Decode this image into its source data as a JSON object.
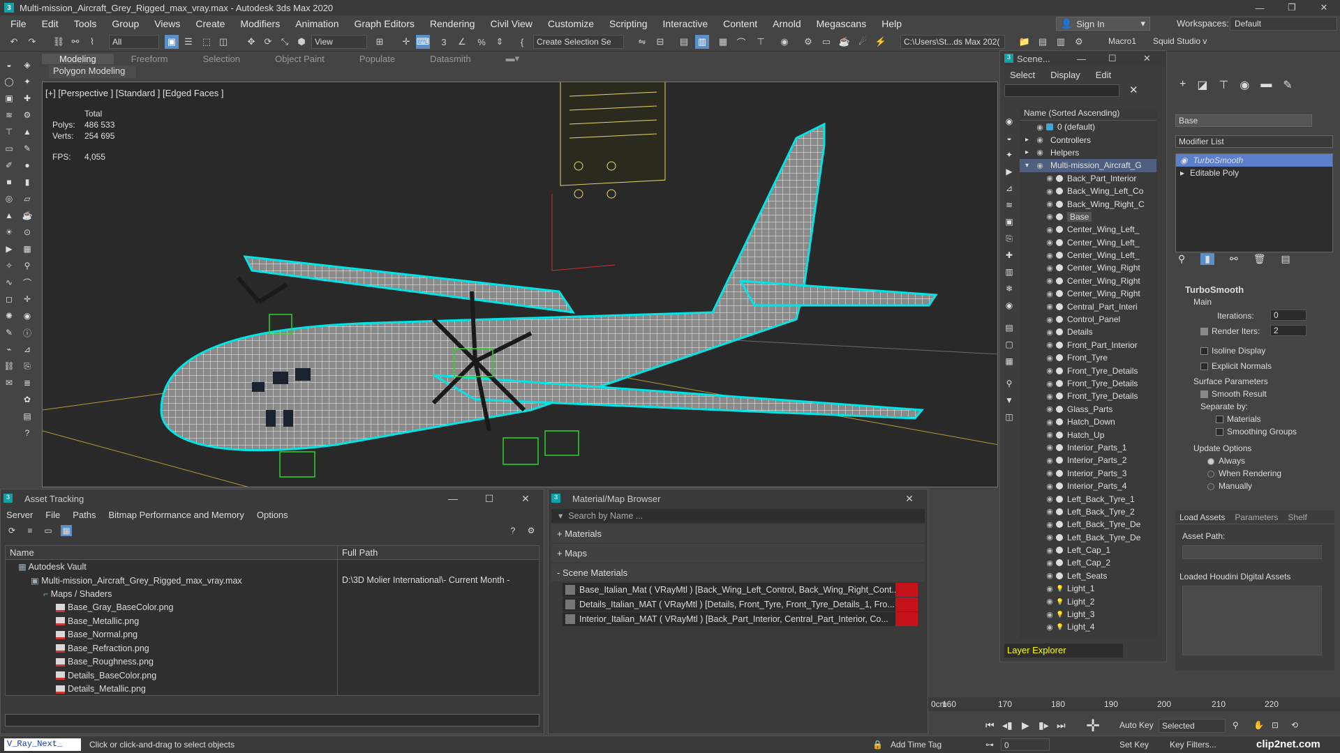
{
  "window": {
    "title": "Multi-mission_Aircraft_Grey_Rigged_max_vray.max - Autodesk 3ds Max 2020",
    "app_badge": "3"
  },
  "menu": [
    "File",
    "Edit",
    "Tools",
    "Group",
    "Views",
    "Create",
    "Modifiers",
    "Animation",
    "Graph Editors",
    "Rendering",
    "Civil View",
    "Customize",
    "Scripting",
    "Interactive",
    "Content",
    "Arnold",
    "Megascans",
    "Help"
  ],
  "account": {
    "sign_in": "Sign In",
    "workspaces_label": "Workspaces:",
    "workspace": "Default"
  },
  "toolbar": {
    "filter": "All",
    "view": "View",
    "selection_set": "Create Selection Se",
    "path": "C:\\Users\\St...ds Max 202(",
    "macro": "Macro1",
    "squid": "Squid Studio v"
  },
  "ribbon": {
    "tabs": [
      "Modeling",
      "Freeform",
      "Selection",
      "Object Paint",
      "Populate",
      "Datasmith"
    ],
    "sub": "Polygon Modeling"
  },
  "viewport": {
    "label": "[+] [Perspective ] [Standard ] [Edged Faces ]",
    "total_label": "Total",
    "polys_label": "Polys:",
    "polys": "486 533",
    "verts_label": "Verts:",
    "verts": "254 695",
    "fps_label": "FPS:",
    "fps": "4,055"
  },
  "scene_explorer": {
    "title": "Scene...",
    "menus": [
      "Select",
      "Display",
      "Edit"
    ],
    "column": "Name (Sorted Ascending)",
    "rows": [
      {
        "name": "0 (default)",
        "level": 0,
        "type": "layer"
      },
      {
        "name": "Controllers",
        "level": 0,
        "type": "group"
      },
      {
        "name": "Helpers",
        "level": 0,
        "type": "group"
      },
      {
        "name": "Multi-mission_Aircraft_G",
        "level": 0,
        "type": "group-open",
        "selected": true
      },
      {
        "name": "Back_Part_Interior",
        "level": 1
      },
      {
        "name": "Back_Wing_Left_Co",
        "level": 1
      },
      {
        "name": "Back_Wing_Right_C",
        "level": 1
      },
      {
        "name": "Base",
        "level": 1,
        "highlight": true
      },
      {
        "name": "Center_Wing_Left_",
        "level": 1
      },
      {
        "name": "Center_Wing_Left_",
        "level": 1
      },
      {
        "name": "Center_Wing_Left_",
        "level": 1
      },
      {
        "name": "Center_Wing_Right",
        "level": 1
      },
      {
        "name": "Center_Wing_Right",
        "level": 1
      },
      {
        "name": "Center_Wing_Right",
        "level": 1
      },
      {
        "name": "Central_Part_Interi",
        "level": 1
      },
      {
        "name": "Control_Panel",
        "level": 1
      },
      {
        "name": "Details",
        "level": 1
      },
      {
        "name": "Front_Part_Interior",
        "level": 1
      },
      {
        "name": "Front_Tyre",
        "level": 1
      },
      {
        "name": "Front_Tyre_Details",
        "level": 1
      },
      {
        "name": "Front_Tyre_Details",
        "level": 1
      },
      {
        "name": "Front_Tyre_Details",
        "level": 1
      },
      {
        "name": "Glass_Parts",
        "level": 1
      },
      {
        "name": "Hatch_Down",
        "level": 1
      },
      {
        "name": "Hatch_Up",
        "level": 1
      },
      {
        "name": "Interior_Parts_1",
        "level": 1
      },
      {
        "name": "Interior_Parts_2",
        "level": 1
      },
      {
        "name": "Interior_Parts_3",
        "level": 1
      },
      {
        "name": "Interior_Parts_4",
        "level": 1
      },
      {
        "name": "Left_Back_Tyre_1",
        "level": 1
      },
      {
        "name": "Left_Back_Tyre_2",
        "level": 1
      },
      {
        "name": "Left_Back_Tyre_De",
        "level": 1
      },
      {
        "name": "Left_Back_Tyre_De",
        "level": 1
      },
      {
        "name": "Left_Cap_1",
        "level": 1
      },
      {
        "name": "Left_Cap_2",
        "level": 1
      },
      {
        "name": "Left_Seats",
        "level": 1
      },
      {
        "name": "Light_1",
        "level": 1,
        "light": true
      },
      {
        "name": "Light_2",
        "level": 1,
        "light": true
      },
      {
        "name": "Light_3",
        "level": 1,
        "light": true
      },
      {
        "name": "Light_4",
        "level": 1,
        "light": true
      }
    ],
    "footer": "Layer Explorer"
  },
  "command_panel": {
    "object_name": "Base",
    "modifier_list": "Modifier List",
    "stack": [
      "TurboSmooth",
      "Editable Poly"
    ],
    "turbosmooth": {
      "title": "TurboSmooth",
      "main": "Main",
      "iterations_label": "Iterations:",
      "iterations": "0",
      "render_iters_label": "Render Iters:",
      "render_iters": "2",
      "isoline": "Isoline Display",
      "explicit_normals": "Explicit Normals",
      "surface_params": "Surface Parameters",
      "smooth_result": "Smooth Result",
      "separate_by": "Separate by:",
      "materials": "Materials",
      "smoothing_groups": "Smoothing Groups",
      "update_options": "Update Options",
      "always": "Always",
      "when_rendering": "When Rendering",
      "manually": "Manually"
    },
    "houdini": {
      "tabs": [
        "Load Assets",
        "Parameters",
        "Shelf"
      ],
      "asset_path": "Asset Path:",
      "loaded": "Loaded Houdini Digital Assets"
    }
  },
  "asset_tracking": {
    "title": "Asset Tracking",
    "menus": [
      "Server",
      "File",
      "Paths",
      "Bitmap Performance and Memory",
      "Options"
    ],
    "columns": [
      "Name",
      "Full Path"
    ],
    "rows": [
      {
        "name": "Autodesk Vault",
        "path": "",
        "indent": 1,
        "kind": "vault"
      },
      {
        "name": "Multi-mission_Aircraft_Grey_Rigged_max_vray.max",
        "path": "D:\\3D Molier International\\- Current Month -",
        "indent": 2,
        "kind": "max"
      },
      {
        "name": "Maps / Shaders",
        "path": "",
        "indent": 3,
        "kind": "maps"
      },
      {
        "name": "Base_Gray_BaseColor.png",
        "path": "",
        "indent": 4,
        "kind": "png"
      },
      {
        "name": "Base_Metallic.png",
        "path": "",
        "indent": 4,
        "kind": "png"
      },
      {
        "name": "Base_Normal.png",
        "path": "",
        "indent": 4,
        "kind": "png"
      },
      {
        "name": "Base_Refraction.png",
        "path": "",
        "indent": 4,
        "kind": "png"
      },
      {
        "name": "Base_Roughness.png",
        "path": "",
        "indent": 4,
        "kind": "png"
      },
      {
        "name": "Details_BaseColor.png",
        "path": "",
        "indent": 4,
        "kind": "png"
      },
      {
        "name": "Details_Metallic.png",
        "path": "",
        "indent": 4,
        "kind": "png"
      }
    ]
  },
  "material_browser": {
    "title": "Material/Map Browser",
    "search": "Search by Name ...",
    "categories": [
      "+ Materials",
      "+ Maps",
      "- Scene Materials"
    ],
    "items": [
      "Base_Italian_Mat ( VRayMtl ) [Back_Wing_Left_Control, Back_Wing_Right_Cont...",
      "Details_Italian_MAT ( VRayMtl ) [Details, Front_Tyre, Front_Tyre_Details_1, Fro...",
      "Interior_Italian_MAT ( VRayMtl ) [Back_Part_Interior, Central_Part_Interior, Co..."
    ]
  },
  "timeline": {
    "ticks": [
      "160",
      "170",
      "180",
      "190",
      "200",
      "210",
      "220"
    ],
    "partial": "0cm"
  },
  "status": {
    "script": "V_Ray_Next_",
    "prompt": "Click or click-and-drag to select objects",
    "add_time_tag": "Add Time Tag",
    "auto_key": "Auto Key",
    "selected": "Selected",
    "set_key": "Set Key",
    "key_filters": "Key Filters...",
    "frame": "0",
    "watermark": "clip2net.com"
  },
  "colors": {
    "selection": "#00e6e6",
    "accent": "#5a8fc8",
    "viewport_bg": "#292929"
  }
}
